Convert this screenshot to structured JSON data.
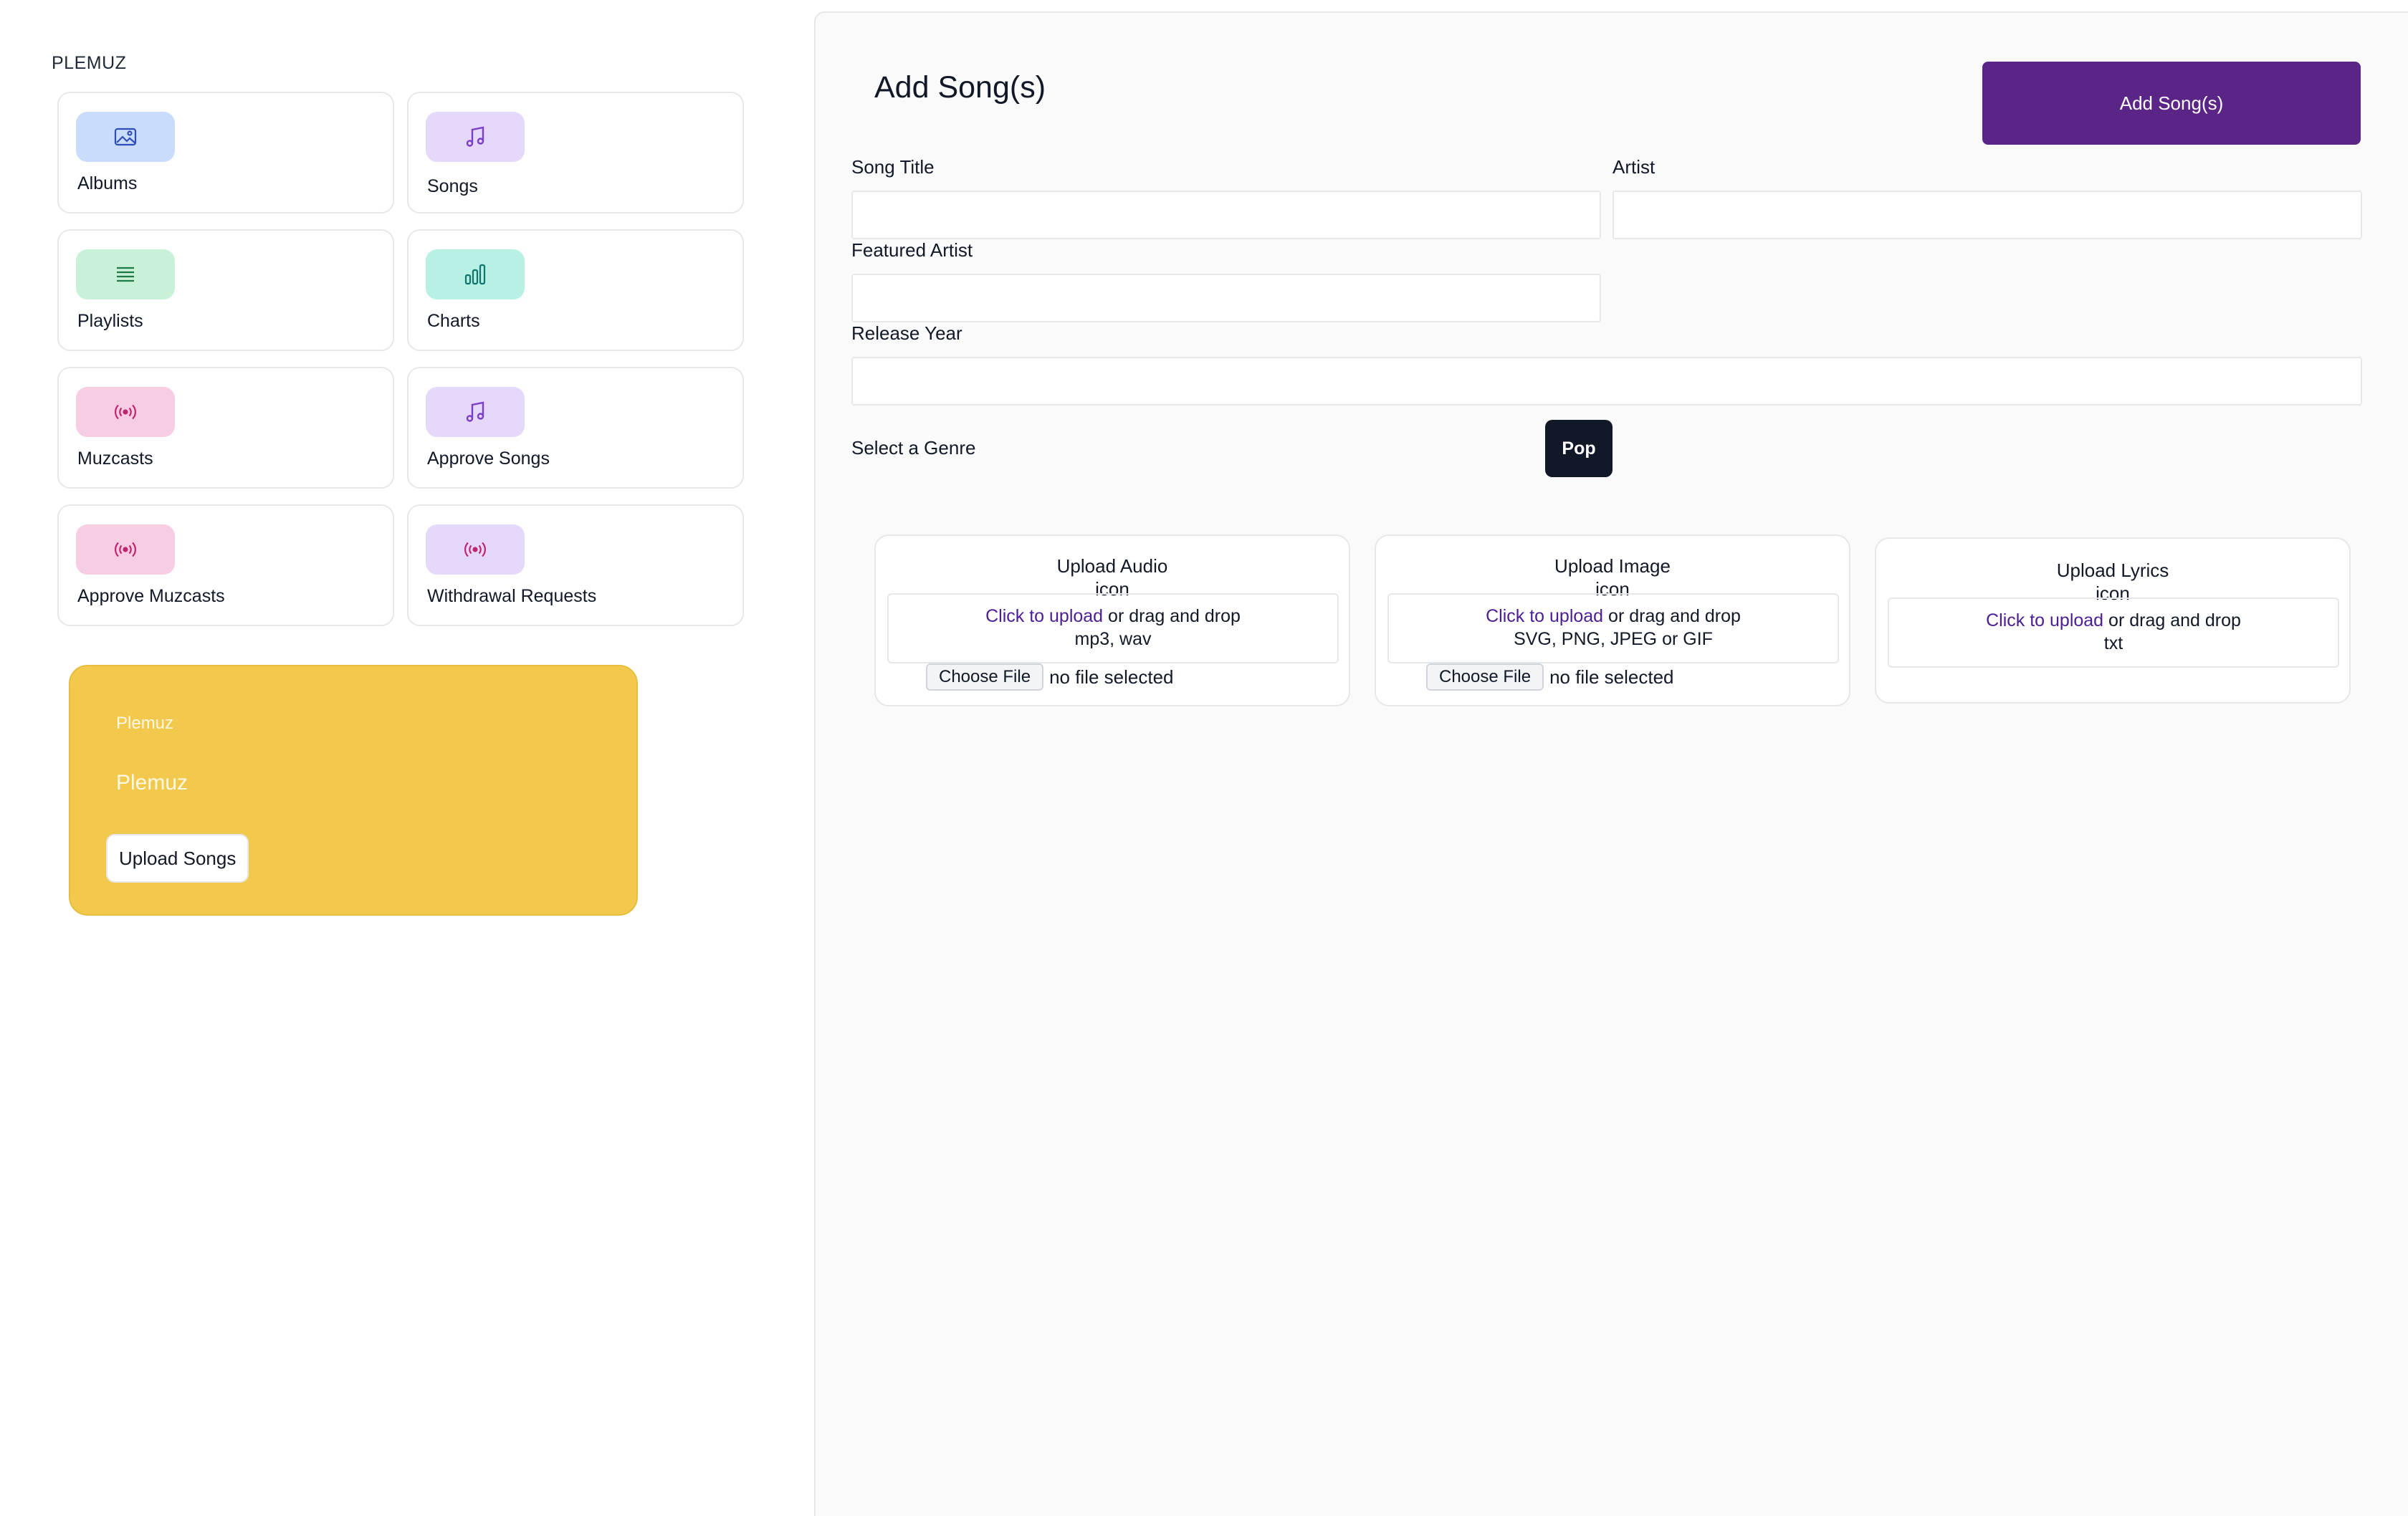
{
  "brand": "PLEMUZ",
  "tiles": [
    {
      "label": "Albums",
      "icon": "image-icon",
      "chip_color": "#c9dcfb",
      "icon_color": "#2f4fb8"
    },
    {
      "label": "Songs",
      "icon": "music-note-icon",
      "chip_color": "#e5d8fb",
      "icon_color": "#7a3fc9"
    },
    {
      "label": "Playlists",
      "icon": "list-icon",
      "chip_color": "#c8f1d8",
      "icon_color": "#1f7a45"
    },
    {
      "label": "Charts",
      "icon": "bar-chart-icon",
      "chip_color": "#b7f1e5",
      "icon_color": "#0f766e"
    },
    {
      "label": "Muzcasts",
      "icon": "broadcast-icon",
      "chip_color": "#f7cde3",
      "icon_color": "#c0266f"
    },
    {
      "label": "Approve Songs",
      "icon": "music-note-icon",
      "chip_color": "#e5d8fb",
      "icon_color": "#7a3fc9"
    },
    {
      "label": "Approve Muzcasts",
      "icon": "broadcast-icon",
      "chip_color": "#f7cde3",
      "icon_color": "#c0266f"
    },
    {
      "label": "Withdrawal Requests",
      "icon": "broadcast-icon",
      "chip_color": "#e5d8fb",
      "icon_color": "#c0266f"
    }
  ],
  "promo": {
    "small": "Plemuz",
    "big": "Plemuz",
    "button": "Upload Songs",
    "bg_color": "#f2c94c"
  },
  "form": {
    "title": "Add Song(s)",
    "submit": "Add Song(s)",
    "accent_color": "#5b2588",
    "fields": {
      "song_title": {
        "label": "Song Title",
        "value": ""
      },
      "artist": {
        "label": "Artist",
        "value": ""
      },
      "featured_artist": {
        "label": "Featured Artist",
        "value": ""
      },
      "release_year": {
        "label": "Release Year",
        "value": ""
      }
    },
    "genre_label": "Select a Genre",
    "genre_selected": "Pop",
    "uploads": [
      {
        "title": "Upload Audio",
        "icon_text": "icon",
        "link": "Click to upload",
        "rest": " or drag and drop",
        "formats": "mp3, wav",
        "choose": "Choose File",
        "status": "no file selected"
      },
      {
        "title": "Upload Image",
        "icon_text": "icon",
        "link": "Click to upload",
        "rest": " or drag and drop",
        "formats": "SVG, PNG, JPEG or GIF",
        "choose": "Choose File",
        "status": "no file selected"
      },
      {
        "title": "Upload Lyrics",
        "icon_text": "icon",
        "link": "Click to upload",
        "rest": " or drag and drop",
        "formats": "txt"
      }
    ]
  }
}
